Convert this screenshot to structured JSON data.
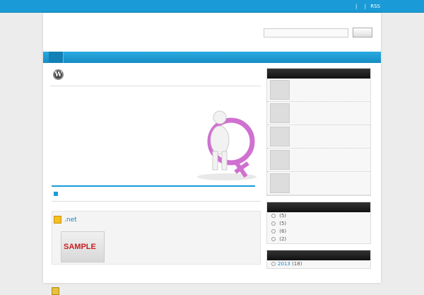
{
  "topbar": {
    "breadcrumb": "",
    "links": [
      "",
      "",
      "RSS"
    ]
  },
  "header": {
    "site_title": "",
    "site_description": "",
    "search_placeholder": "",
    "search_button": ""
  },
  "nav": {
    "items": [
      ""
    ]
  },
  "entry": {
    "title": "",
    "paragraphs": [
      "",
      "",
      "",
      ""
    ]
  },
  "subsection": {
    "title": ""
  },
  "post1": {
    "title_suffix": ".net",
    "thumb_label": "SAMPLE",
    "lines": [
      "",
      "",
      "",
      ""
    ]
  },
  "post2": {
    "title": ""
  },
  "sidebar": {
    "recent": {
      "heading": "",
      "items": [
        {
          "title": "",
          "icon": "scales-icon"
        },
        {
          "title": "",
          "icon": "figures-icon"
        },
        {
          "title": "",
          "icon": "coins-icon"
        },
        {
          "title": "",
          "icon": "documents-icon"
        },
        {
          "title": "",
          "icon": "figure-icon"
        }
      ]
    },
    "categories": {
      "heading": "",
      "items": [
        {
          "name": "",
          "count": "(5)"
        },
        {
          "name": "",
          "count": "(5)"
        },
        {
          "name": "",
          "count": "(6)"
        },
        {
          "name": "",
          "count": "(2)"
        }
      ]
    },
    "archives": {
      "heading": "",
      "items": [
        {
          "name": "2013",
          "count": "(18)"
        }
      ]
    }
  },
  "colors": {
    "accent": "#1a9bd7",
    "link": "#1a7ec0",
    "dark": "#111111"
  }
}
